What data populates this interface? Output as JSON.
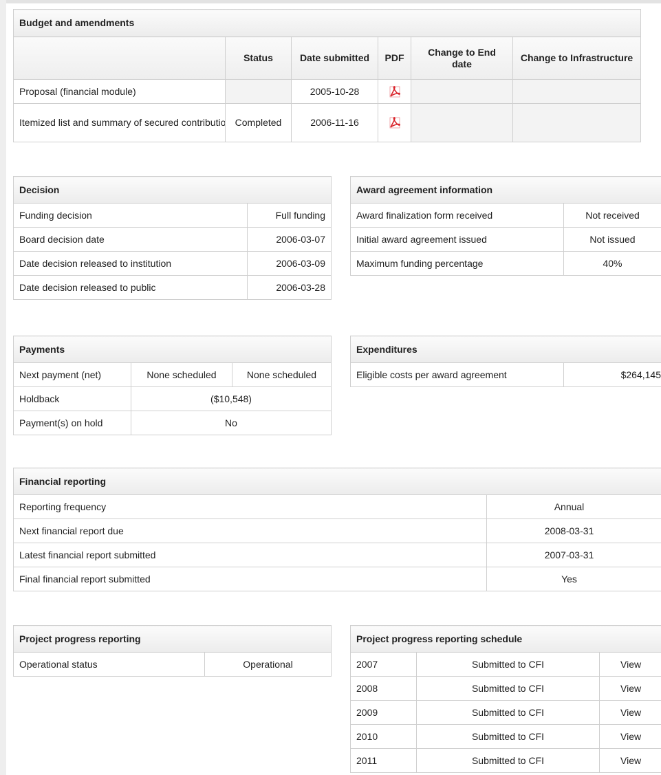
{
  "budget": {
    "title": "Budget and amendments",
    "headers": {
      "status": "Status",
      "date_submitted": "Date submitted",
      "pdf": "PDF",
      "change_end": "Change to End date",
      "change_infra": "Change to Infrastructure"
    },
    "rows": [
      {
        "name": "Proposal (financial module)",
        "status": "",
        "date": "2005-10-28"
      },
      {
        "name": "Itemized list and summary of secured contributions",
        "status": "Completed",
        "date": "2006-11-16"
      }
    ],
    "pdf_icon": "pdf-icon",
    "pdf_color": "#d9232a"
  },
  "decision": {
    "title": "Decision",
    "rows": [
      {
        "label": "Funding decision",
        "value": "Full funding"
      },
      {
        "label": "Board decision date",
        "value": "2006-03-07"
      },
      {
        "label": "Date decision released to institution",
        "value": "2006-03-09"
      },
      {
        "label": "Date decision released to public",
        "value": "2006-03-28"
      }
    ]
  },
  "award": {
    "title": "Award agreement information",
    "rows": [
      {
        "label": "Award finalization form received",
        "value": "Not received"
      },
      {
        "label": "Initial award agreement issued",
        "value": "Not issued"
      },
      {
        "label": "Maximum funding percentage",
        "value": "40%"
      }
    ]
  },
  "payments": {
    "title": "Payments",
    "next_label": "Next payment (net)",
    "next_value1": "None scheduled",
    "next_value2": "None scheduled",
    "holdback_label": "Holdback",
    "holdback_value": "($10,548)",
    "hold_label": "Payment(s) on hold",
    "hold_value": "No"
  },
  "expenditures": {
    "title": "Expenditures",
    "label": "Eligible costs per award agreement",
    "value": "$264,145"
  },
  "financial": {
    "title": "Financial reporting",
    "rows": [
      {
        "label": "Reporting frequency",
        "value": "Annual"
      },
      {
        "label": "Next financial report due",
        "value": "2008-03-31"
      },
      {
        "label": "Latest financial report submitted",
        "value": "2007-03-31"
      },
      {
        "label": "Final financial report submitted",
        "value": "Yes"
      }
    ]
  },
  "progress": {
    "title": "Project progress reporting",
    "label": "Operational status",
    "value": "Operational"
  },
  "schedule": {
    "title": "Project progress reporting schedule",
    "rows": [
      {
        "year": "2007",
        "status": "Submitted to CFI",
        "action": "View"
      },
      {
        "year": "2008",
        "status": "Submitted to CFI",
        "action": "View"
      },
      {
        "year": "2009",
        "status": "Submitted to CFI",
        "action": "View"
      },
      {
        "year": "2010",
        "status": "Submitted to CFI",
        "action": "View"
      },
      {
        "year": "2011",
        "status": "Submitted to CFI",
        "action": "View"
      }
    ]
  }
}
